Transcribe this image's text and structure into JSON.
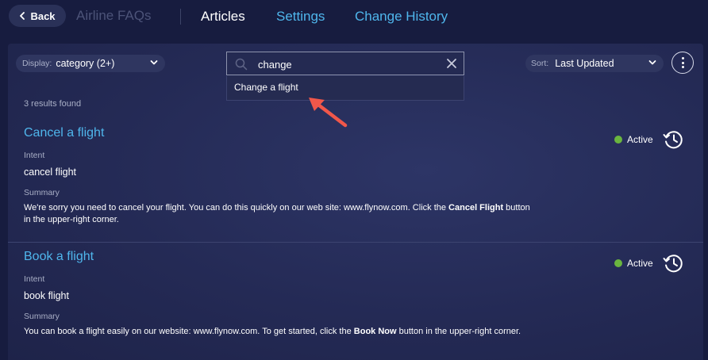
{
  "topbar": {
    "back_label": "Back",
    "app_title": "Airline FAQs",
    "nav": {
      "articles": "Articles",
      "settings": "Settings",
      "change_history": "Change History"
    }
  },
  "toolbar": {
    "display_label": "Display:",
    "display_value": "category (2+)",
    "search_value": "change",
    "search_suggestion": "Change a flight",
    "sort_label": "Sort:",
    "sort_value": "Last Updated"
  },
  "results": {
    "count_text": "3 results found",
    "articles": [
      {
        "title": "Cancel a flight",
        "intent_label": "Intent",
        "intent": "cancel flight",
        "summary_label": "Summary",
        "summary_before": "We're sorry you need to cancel your flight. You can do this quickly on our web site: www.flynow.com. Click the ",
        "summary_bold": "Cancel Flight",
        "summary_after": " button in the upper-right corner.",
        "status": "Active"
      },
      {
        "title": "Book a flight",
        "intent_label": "Intent",
        "intent": "book flight",
        "summary_label": "Summary",
        "summary_before": "You can book a flight easily on our website: www.flynow.com. To get started, click the ",
        "summary_bold": "Book Now",
        "summary_after": " button in the upper-right corner.",
        "status": "Active"
      }
    ]
  },
  "colors": {
    "accent": "#4fb6ec",
    "status_active": "#6ab53f",
    "annotation_arrow": "#f0574a"
  },
  "icons": [
    "chevron-left-icon",
    "chevron-down-icon",
    "search-icon",
    "close-icon",
    "more-vertical-icon",
    "history-icon",
    "arrow-annotation-icon"
  ]
}
